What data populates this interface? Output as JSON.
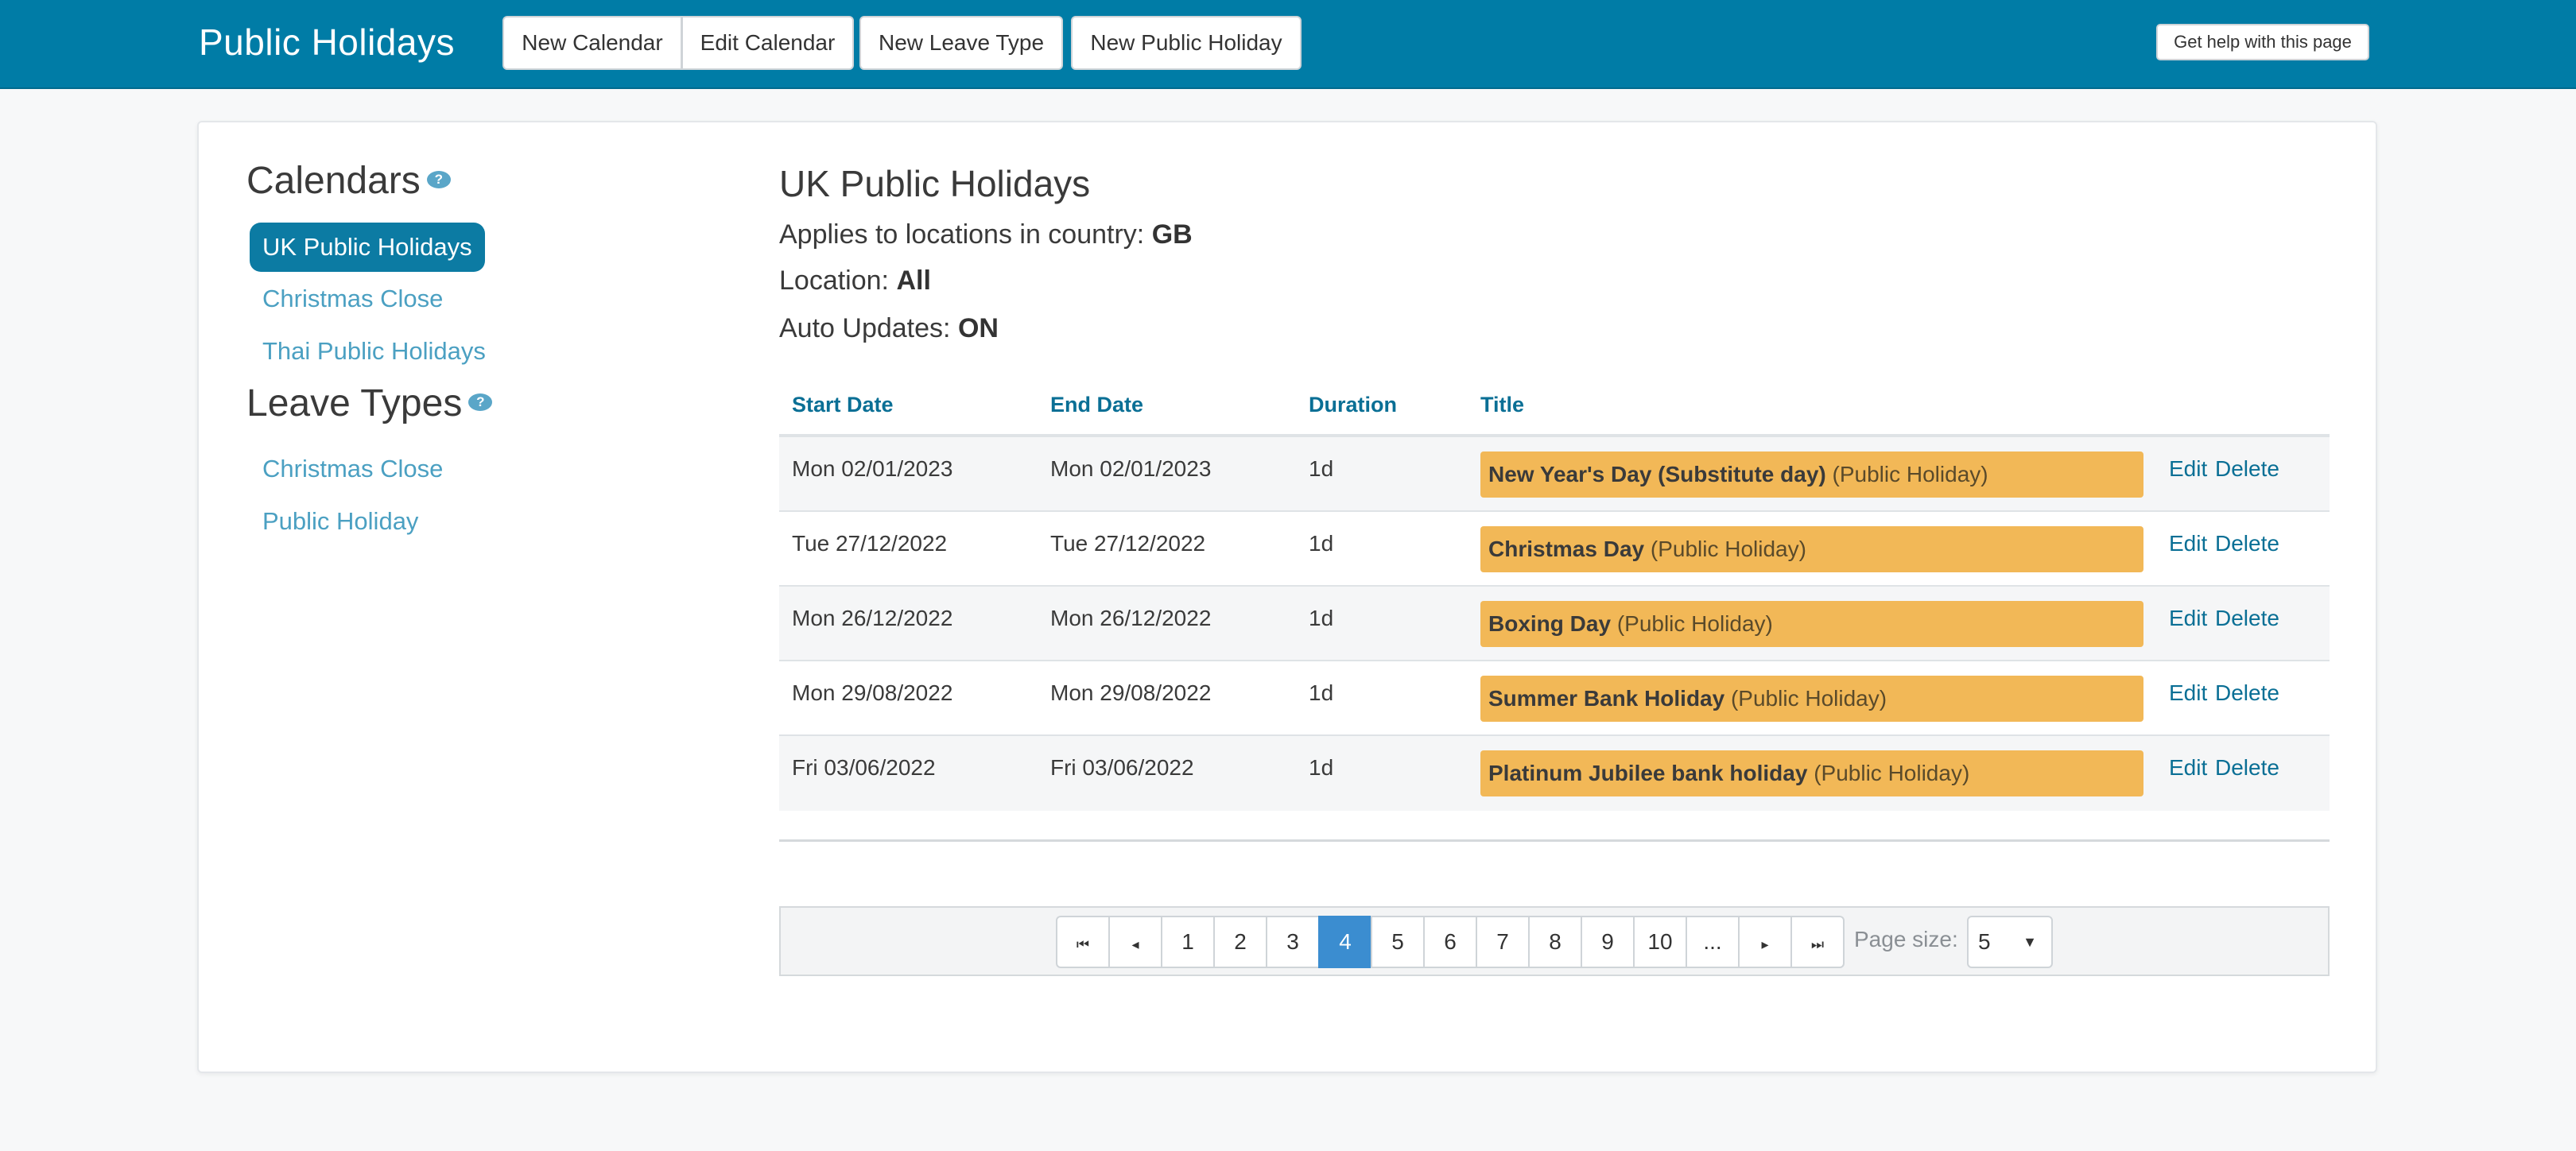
{
  "header": {
    "title": "Public Holidays",
    "buttons": {
      "new_calendar": "New Calendar",
      "edit_calendar": "Edit Calendar",
      "new_leave_type": "New Leave Type",
      "new_public_holiday": "New Public Holiday"
    },
    "help": "Get help with this page"
  },
  "sidebar": {
    "calendars_heading": "Calendars",
    "calendars": [
      {
        "label": "UK Public Holidays",
        "active": true
      },
      {
        "label": "Christmas Close",
        "active": false
      },
      {
        "label": "Thai Public Holidays",
        "active": false
      }
    ],
    "leave_types_heading": "Leave Types",
    "leave_types": [
      {
        "label": "Christmas Close"
      },
      {
        "label": "Public Holiday"
      }
    ],
    "help_glyph": "?"
  },
  "main": {
    "title": "UK Public Holidays",
    "country_label": "Applies to locations in country:",
    "country_value": "GB",
    "location_label": "Location:",
    "location_value": "All",
    "auto_updates_label": "Auto Updates:",
    "auto_updates_value": "ON",
    "columns": [
      "Start Date",
      "End Date",
      "Duration",
      "Title"
    ],
    "rows": [
      {
        "start": "Mon 02/01/2023",
        "end": "Mon 02/01/2023",
        "duration": "1d",
        "name": "New Year's Day (Substitute day)",
        "type": "(Public Holiday)",
        "edit": "Edit",
        "delete": "Delete"
      },
      {
        "start": "Tue 27/12/2022",
        "end": "Tue 27/12/2022",
        "duration": "1d",
        "name": "Christmas Day",
        "type": "(Public Holiday)",
        "edit": "Edit",
        "delete": "Delete"
      },
      {
        "start": "Mon 26/12/2022",
        "end": "Mon 26/12/2022",
        "duration": "1d",
        "name": "Boxing Day",
        "type": "(Public Holiday)",
        "edit": "Edit",
        "delete": "Delete"
      },
      {
        "start": "Mon 29/08/2022",
        "end": "Mon 29/08/2022",
        "duration": "1d",
        "name": "Summer Bank Holiday",
        "type": "(Public Holiday)",
        "edit": "Edit",
        "delete": "Delete"
      },
      {
        "start": "Fri 03/06/2022",
        "end": "Fri 03/06/2022",
        "duration": "1d",
        "name": "Platinum Jubilee bank holiday",
        "type": "(Public Holiday)",
        "edit": "Edit",
        "delete": "Delete"
      }
    ]
  },
  "pagination": {
    "first_glyph": "⏮",
    "prev_glyph": "◂",
    "next_glyph": "▸",
    "last_glyph": "⏭",
    "pages": [
      "1",
      "2",
      "3",
      "4",
      "5",
      "6",
      "7",
      "8",
      "9",
      "10",
      "..."
    ],
    "current_page": "4",
    "page_size_label": "Page size:",
    "page_size_value": "5",
    "caret_glyph": "▼"
  },
  "colors": {
    "header_bg": "#007ca6",
    "active_item": "#0c7ba3",
    "link": "#4ba0c2",
    "holiday_tag": "#f2b857",
    "active_page": "#3b8dd0"
  }
}
